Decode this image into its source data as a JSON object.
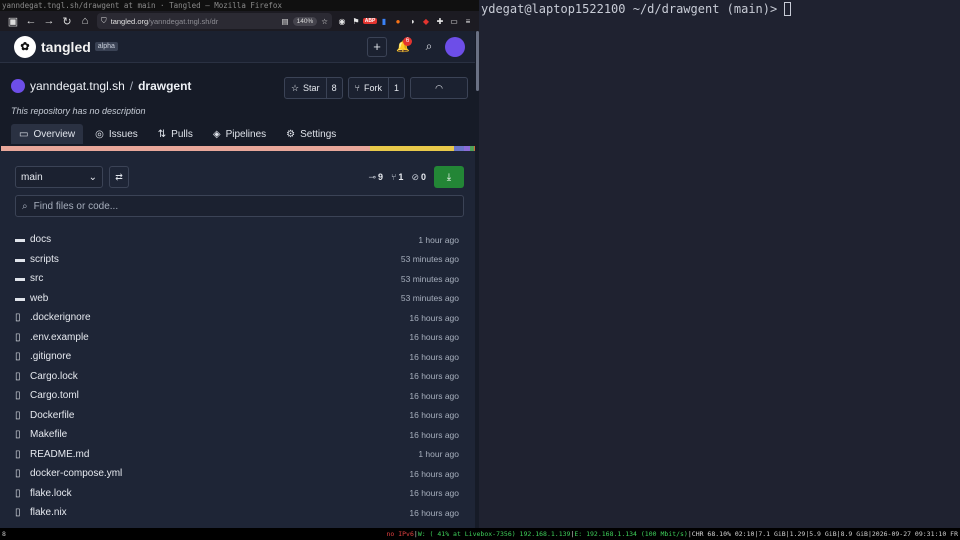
{
  "window": {
    "title": "yanndegat.tngl.sh/drawgent at main · Tangled — Mozilla Firefox"
  },
  "browser": {
    "url_host": "tangled.org",
    "url_path": "/yanndegat.tngl.sh/dr",
    "zoom": "140%"
  },
  "site": {
    "brand": "tangled",
    "badge": "alpha",
    "notifications": "6"
  },
  "repo": {
    "owner": "yanndegat.tngl.sh",
    "separator": "/",
    "name": "drawgent",
    "description": "This repository has no description",
    "star_label": "Star",
    "star_count": "8",
    "fork_label": "Fork",
    "fork_count": "1"
  },
  "tabs": [
    {
      "label": "Overview"
    },
    {
      "label": "Issues"
    },
    {
      "label": "Pulls"
    },
    {
      "label": "Pipelines"
    },
    {
      "label": "Settings"
    }
  ],
  "language_bar": [
    {
      "color": "#e8a79a",
      "fraction": 0.773
    },
    {
      "color": "#e8c94a",
      "fraction": 0.174
    },
    {
      "color": "#6b76c9",
      "fraction": 0.022
    },
    {
      "color": "#8a6cd8",
      "fraction": 0.012
    },
    {
      "color": "#4fa05a",
      "fraction": 0.008
    },
    {
      "color": "#d26b3a",
      "fraction": 0.011
    }
  ],
  "controls": {
    "branch": "main",
    "commits": "9",
    "branches": "1",
    "tags": "0",
    "search_placeholder": "Find files or code..."
  },
  "files": [
    {
      "type": "folder",
      "name": "docs",
      "time": "1 hour ago"
    },
    {
      "type": "folder",
      "name": "scripts",
      "time": "53 minutes ago"
    },
    {
      "type": "folder",
      "name": "src",
      "time": "53 minutes ago"
    },
    {
      "type": "folder",
      "name": "web",
      "time": "53 minutes ago"
    },
    {
      "type": "file",
      "name": ".dockerignore",
      "time": "16 hours ago"
    },
    {
      "type": "file",
      "name": ".env.example",
      "time": "16 hours ago"
    },
    {
      "type": "file",
      "name": ".gitignore",
      "time": "16 hours ago"
    },
    {
      "type": "file",
      "name": "Cargo.lock",
      "time": "16 hours ago"
    },
    {
      "type": "file",
      "name": "Cargo.toml",
      "time": "16 hours ago"
    },
    {
      "type": "file",
      "name": "Dockerfile",
      "time": "16 hours ago"
    },
    {
      "type": "file",
      "name": "Makefile",
      "time": "16 hours ago"
    },
    {
      "type": "file",
      "name": "README.md",
      "time": "1 hour ago"
    },
    {
      "type": "file",
      "name": "docker-compose.yml",
      "time": "16 hours ago"
    },
    {
      "type": "file",
      "name": "flake.lock",
      "time": "16 hours ago"
    },
    {
      "type": "file",
      "name": "flake.nix",
      "time": "16 hours ago"
    }
  ],
  "terminal": {
    "prompt_user": "ydegat@laptop1522100",
    "prompt_path": " ~/d/drawgent (main)> "
  },
  "statusbar": {
    "workspace": "8",
    "ipv6": "no IPv6",
    "wifi": "W: ( 41% at Livebox-7356) 192.168.1.139",
    "eth": "E: 192.168.1.134 (100 Mbit/s)",
    "battery": "CHR 68.10% 02:10",
    "mem": "7.1 GiB",
    "load": "1.29",
    "disk1": "5.9 GiB",
    "disk2": "8.9 GiB",
    "datetime": "2026-09-27 09:31:10",
    "layout": "FR"
  }
}
